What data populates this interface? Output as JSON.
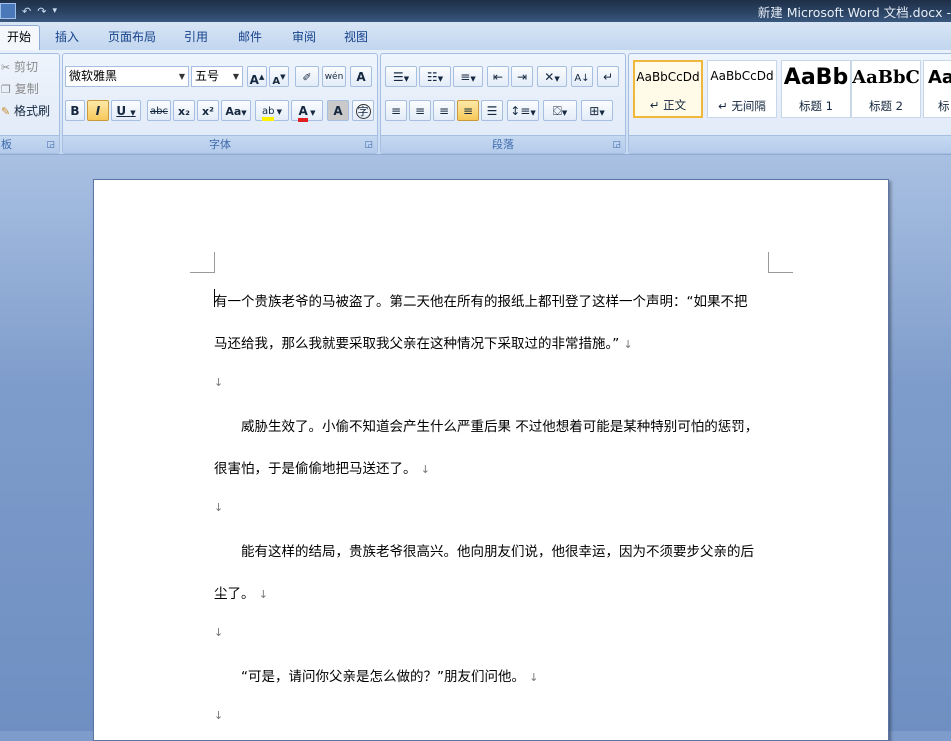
{
  "window": {
    "title": "新建 Microsoft Word 文档.docx -"
  },
  "tabs": [
    "开始",
    "插入",
    "页面布局",
    "引用",
    "邮件",
    "审阅",
    "视图"
  ],
  "clipboard": {
    "cut": "剪切",
    "copy": "复制",
    "format_painter": "格式刷",
    "label": "板"
  },
  "font": {
    "name": "微软雅黑",
    "size": "五号",
    "label": "字体",
    "grow": "A",
    "shrink": "A",
    "clear": "A",
    "bold": "B",
    "italic": "I",
    "underline": "U",
    "strike": "abc",
    "subscript": "x₂",
    "superscript": "x²",
    "case": "Aa",
    "highlight": "ab",
    "color": "A",
    "shade": "A",
    "enclose": "字",
    "phonetic": "wén"
  },
  "paragraph": {
    "label": "段落"
  },
  "styles": [
    {
      "sample": "AaBbCcDd",
      "name": "↵ 正文"
    },
    {
      "sample": "AaBbCcDd",
      "name": "↵ 无间隔"
    },
    {
      "sample": "AaBb",
      "name": "标题 1"
    },
    {
      "sample": "AaBbC",
      "name": "标题 2"
    },
    {
      "sample": "Aa",
      "name": "标"
    }
  ],
  "document": {
    "lines": [
      "有一个贵族老爷的马被盗了。第二天他在所有的报纸上都刊登了这样一个声明：“如果不把",
      "马还给我，那么我就要采取我父亲在这种情况下采取过的非常措施。”",
      "",
      "　　威胁生效了。小偷不知道会产生什么严重后果 不过他想着可能是某种特别可怕的惩罚，",
      "很害怕，于是偷偷地把马送还了。",
      "",
      "　　能有这样的结局，贵族老爷很高兴。他向朋友们说，他很幸运，因为不须要步父亲的后",
      "尘了。",
      "",
      "　　“可是，请问你父亲是怎么做的？”朋友们问他。",
      ""
    ],
    "paragraph_mark": "↓"
  }
}
